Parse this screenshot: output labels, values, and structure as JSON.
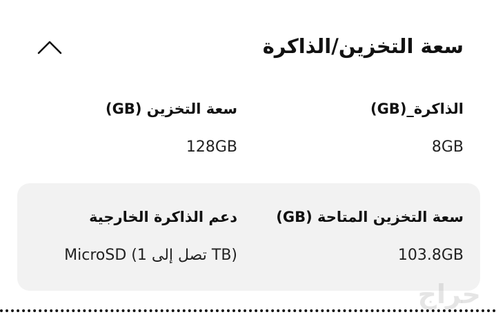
{
  "section": {
    "title": "سعة التخزين/الذاكرة",
    "toggle_icon": "chevron-up-icon"
  },
  "specs": {
    "memory": {
      "label": "الذاكرة_(GB)",
      "value": "8GB"
    },
    "storage": {
      "label": "سعة التخزين (GB)",
      "value": "128GB"
    },
    "available_storage": {
      "label": "سعة التخزين المتاحة (GB)",
      "value": "103.8GB"
    },
    "external_memory": {
      "label": "دعم الذاكرة الخارجية",
      "value": "MicroSD (تصل إلى 1 TB)"
    }
  },
  "watermark": {
    "text": "حراج"
  },
  "colors": {
    "card_background": "#f2f2f2",
    "text": "#111111"
  }
}
